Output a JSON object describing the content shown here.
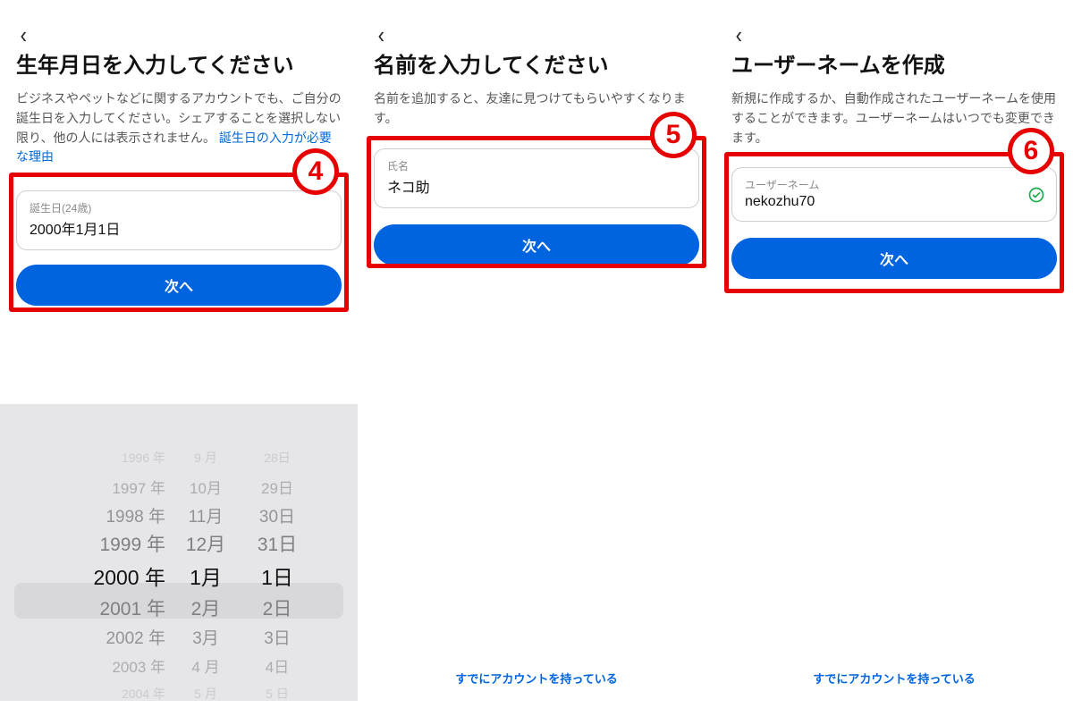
{
  "screens": {
    "birthday": {
      "badge": "4",
      "title": "生年月日を入力してください",
      "desc_pre": "ビジネスやペットなどに関するアカウントでも、ご自分の誕生日を入力してください。シェアすることを選択しない限り、他の人には表示されません。",
      "desc_link": "誕生日の入力が必要な理由",
      "field_label": "誕生日(24歳)",
      "field_value": "2000年1月1日",
      "next": "次へ"
    },
    "name": {
      "badge": "5",
      "title": "名前を入力してください",
      "desc": "名前を追加すると、友達に見つけてもらいやすくなります。",
      "field_label": "氏名",
      "field_value": "ネコ助",
      "next": "次へ",
      "footer": "すでにアカウントを持っている"
    },
    "username": {
      "badge": "6",
      "title": "ユーザーネームを作成",
      "desc": "新規に作成するか、自動作成されたユーザーネームを使用することができます。ユーザーネームはいつでも変更できます。",
      "field_label": "ユーザーネーム",
      "field_value": "nekozhu70",
      "next": "次へ",
      "footer": "すでにアカウントを持っている"
    }
  },
  "picker": {
    "years": [
      "1996 年",
      "1997 年",
      "1998 年",
      "1999 年",
      "2000 年",
      "2001 年",
      "2002 年",
      "2003 年",
      "2004 年"
    ],
    "months": [
      "9 月",
      "10月",
      "11月",
      "12月",
      "1月",
      "2月",
      "3月",
      "4 月",
      "5 月"
    ],
    "days": [
      "28日",
      "29日",
      "30日",
      "31日",
      "1日",
      "2日",
      "3日",
      "4日",
      "5 日"
    ]
  }
}
